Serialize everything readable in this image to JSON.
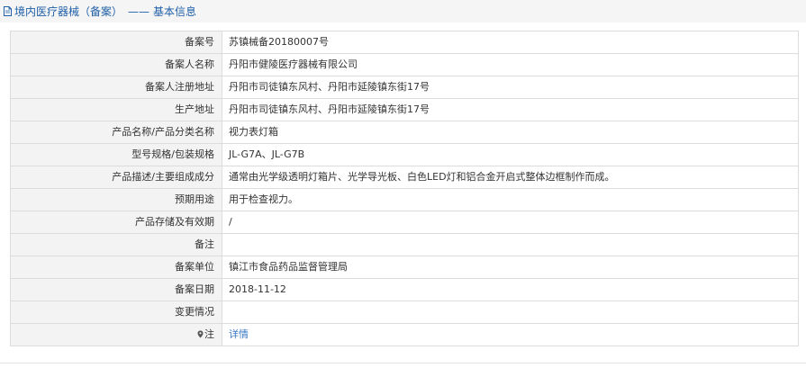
{
  "header": {
    "title": "境内医疗器械（备案）",
    "separator": "——",
    "subtitle": "基本信息",
    "icon": "document-icon"
  },
  "rows": [
    {
      "label": "备案号",
      "value": "苏镇械备20180007号"
    },
    {
      "label": "备案人名称",
      "value": "丹阳市健陵医疗器械有限公司"
    },
    {
      "label": "备案人注册地址",
      "value": "丹阳市司徒镇东风村、丹阳市延陵镇东街17号"
    },
    {
      "label": "生产地址",
      "value": "丹阳市司徒镇东风村、丹阳市延陵镇东街17号"
    },
    {
      "label": "产品名称/产品分类名称",
      "value": "视力表灯箱"
    },
    {
      "label": "型号规格/包装规格",
      "value": "JL-G7A、JL-G7B"
    },
    {
      "label": "产品描述/主要组成成分",
      "value": "通常由光学级透明灯箱片、光学导光板、白色LED灯和铝合金开启式整体边框制作而成。"
    },
    {
      "label": "预期用途",
      "value": "用于检查视力。"
    },
    {
      "label": "产品存储及有效期",
      "value": "/"
    },
    {
      "label": "备注",
      "value": ""
    },
    {
      "label": "备案单位",
      "value": "镇江市食品药品监督管理局"
    },
    {
      "label": "备案日期",
      "value": "2018-11-12"
    },
    {
      "label": "变更情况",
      "value": ""
    }
  ],
  "note_row": {
    "label": "注",
    "icon": "marker-icon",
    "link_text": "详情"
  },
  "colors": {
    "header_text": "#1f5fa8",
    "link": "#3a78c3",
    "label_bg": "#f3f3f3",
    "border": "#dcdcdc"
  }
}
